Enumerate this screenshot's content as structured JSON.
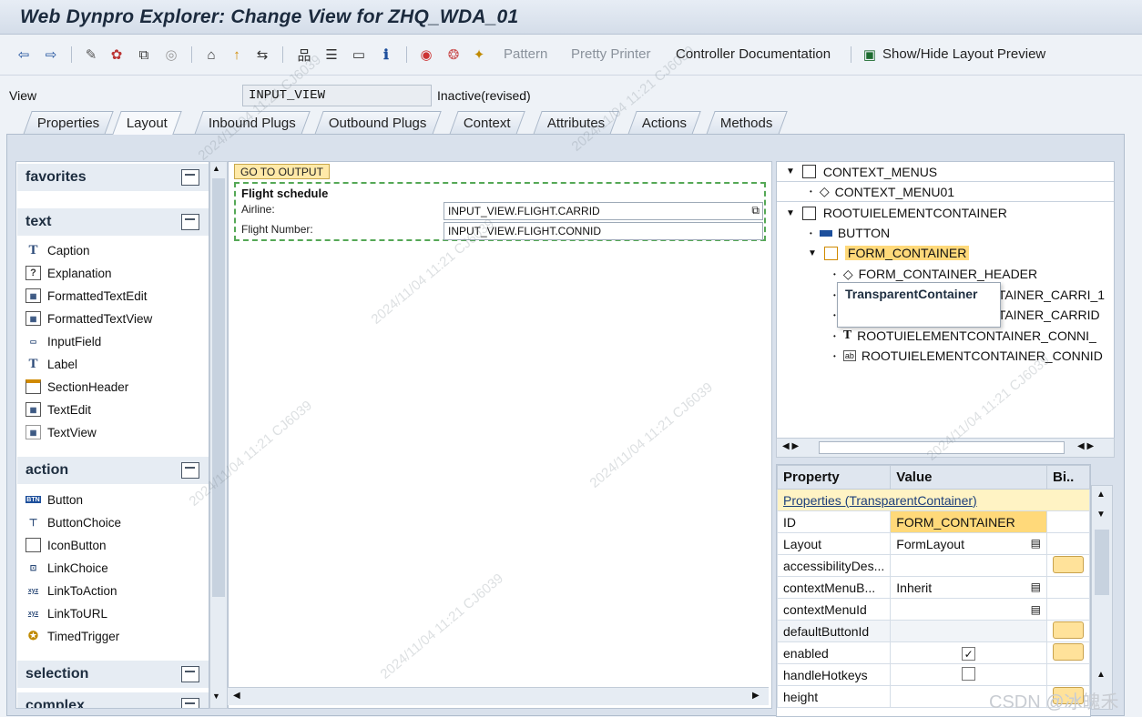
{
  "title": "Web Dynpro Explorer: Change View for ZHQ_WDA_01",
  "toolbar": {
    "pattern": "Pattern",
    "pretty_printer": "Pretty Printer",
    "controller_doc": "Controller Documentation",
    "show_hide": "Show/Hide Layout Preview"
  },
  "view": {
    "label": "View",
    "name": "INPUT_VIEW",
    "status": "Inactive(revised)"
  },
  "tabs": [
    "Properties",
    "Layout",
    "Inbound Plugs",
    "Outbound Plugs",
    "Context",
    "Attributes",
    "Actions",
    "Methods"
  ],
  "library": {
    "favorites": "favorites",
    "text": "text",
    "text_items": [
      "Caption",
      "Explanation",
      "FormattedTextEdit",
      "FormattedTextView",
      "InputField",
      "Label",
      "SectionHeader",
      "TextEdit",
      "TextView"
    ],
    "action": "action",
    "action_items": [
      "Button",
      "ButtonChoice",
      "IconButton",
      "LinkChoice",
      "LinkToAction",
      "LinkToURL",
      "TimedTrigger"
    ],
    "selection": "selection",
    "complex": "complex"
  },
  "canvas": {
    "goto": "GO TO OUTPUT",
    "form_title": "Flight schedule",
    "airline_label": "Airline:",
    "airline_value": "INPUT_VIEW.FLIGHT.CARRID",
    "flight_label": "Flight Number:",
    "flight_value": "INPUT_VIEW.FLIGHT.CONNID"
  },
  "tree": {
    "context_menus": "CONTEXT_MENUS",
    "context_menu01": "CONTEXT_MENU01",
    "root": "ROOTUIELEMENTCONTAINER",
    "button": "BUTTON",
    "form_container": "FORM_CONTAINER",
    "fc_header": "FORM_CONTAINER_HEADER",
    "carri1": "TAINER_CARRI_1",
    "carrid": "TAINER_CARRID",
    "conni": "ROOTUIELEMENTCONTAINER_CONNI_",
    "connid": "ROOTUIELEMENTCONTAINER_CONNID",
    "tooltip": "TransparentContainer"
  },
  "props": {
    "h_property": "Property",
    "h_value": "Value",
    "h_bind": "Bi..",
    "section": "Properties (TransparentContainer)",
    "rows": [
      {
        "p": "ID",
        "v": "FORM_CONTAINER"
      },
      {
        "p": "Layout",
        "v": "FormLayout"
      },
      {
        "p": "accessibilityDes...",
        "v": ""
      },
      {
        "p": "contextMenuB...",
        "v": "Inherit"
      },
      {
        "p": "contextMenuId",
        "v": ""
      },
      {
        "p": "defaultButtonId",
        "v": ""
      },
      {
        "p": "enabled",
        "v": ""
      },
      {
        "p": "handleHotkeys",
        "v": ""
      },
      {
        "p": "height",
        "v": ""
      }
    ]
  },
  "watermark": {
    "date": "2024/11/04 11:21",
    "id": "CJ6039",
    "csdn": "CSDN @冰魄禾"
  }
}
